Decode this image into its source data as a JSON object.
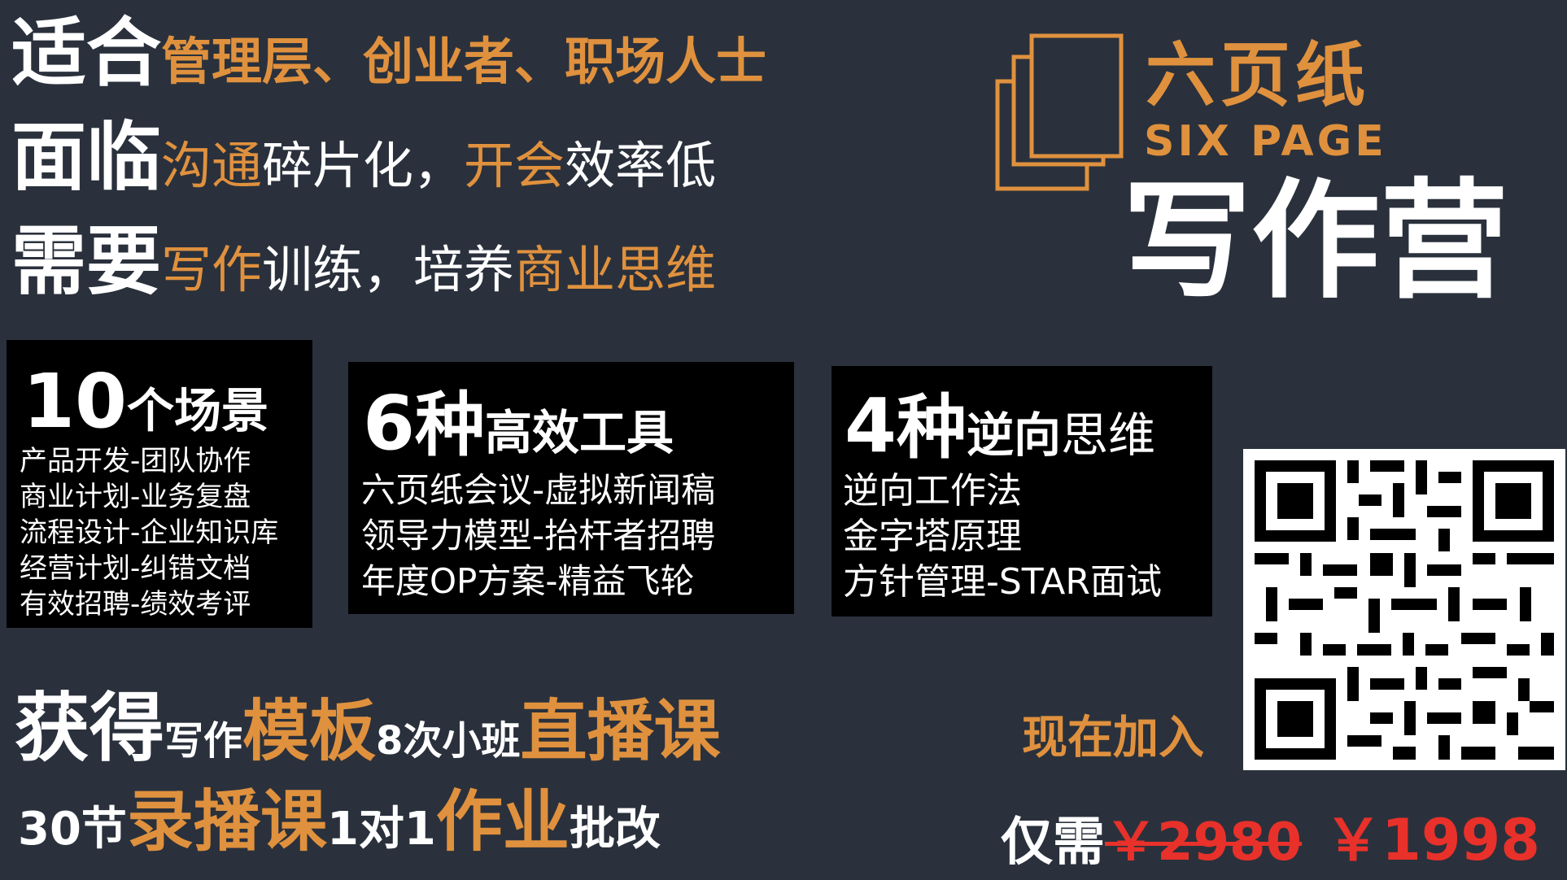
{
  "colors": {
    "background": "#2a313c",
    "accent": "#e0913e",
    "price": "#e8312a",
    "box": "#000000"
  },
  "rows": {
    "r1": {
      "k": "适合",
      "a": "管理层、创业者、职场人士"
    },
    "r2": {
      "k": "面临",
      "a": "沟通",
      "b": "碎片化，",
      "c": "开会",
      "d": "效率低"
    },
    "r3": {
      "k": "需要",
      "a": "写作",
      "b": "训练，培养",
      "c": "商业思维"
    }
  },
  "logo": {
    "cn": "六页纸",
    "en": "SIX PAGE",
    "camp": "写作营",
    "icon": "stacked-pages-icon"
  },
  "box1": {
    "num": "10",
    "unit": "个场景",
    "items": [
      "产品开发-团队协作",
      "商业计划-业务复盘",
      "流程设计-企业知识库",
      "经营计划-纠错文档",
      "有效招聘-绩效考评"
    ]
  },
  "box2": {
    "num": "6",
    "unit": "种",
    "title": "高效工具",
    "items": [
      "六页纸会议-虚拟新闻稿",
      "领导力模型-抬杆者招聘",
      "年度OP方案-精益飞轮"
    ]
  },
  "box3": {
    "num": "4",
    "unit": "种",
    "title_a": "逆向",
    "title_b": "思维",
    "items": [
      "逆向工作法",
      "金字塔原理",
      "方针管理-STAR面试"
    ]
  },
  "get": {
    "k": "获得",
    "a": "写作",
    "b": "模板",
    "c": "8次小班",
    "d": "直播课",
    "e": "30节",
    "f": "录播课",
    "g": "1对1",
    "h": "作业",
    "i": "批改"
  },
  "cta": {
    "join": "现在加入",
    "label": "仅需",
    "old_price": "￥2980",
    "new_price": "￥1998"
  },
  "qr": {
    "icon": "qr-code-icon"
  }
}
